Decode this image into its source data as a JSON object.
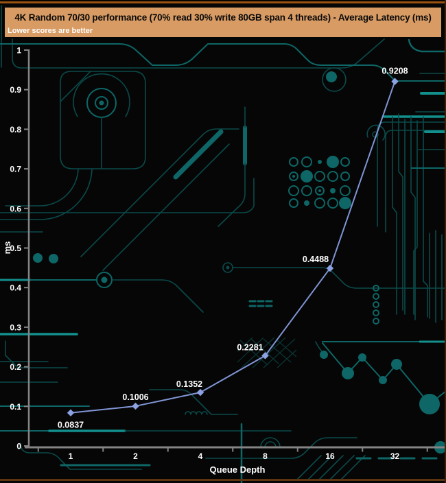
{
  "chart_data": {
    "type": "line",
    "title": "4K Random 70/30 performance (70% read 30% write 80GB span 4 threads) - Average Latency (ms)",
    "subtitle": "Lower scores are better",
    "categories": [
      "1",
      "2",
      "4",
      "8",
      "16",
      "32"
    ],
    "series": [
      {
        "name": "Average Latency",
        "values": [
          0.0837,
          0.1006,
          0.1352,
          0.2281,
          0.4488,
          0.9208
        ],
        "point_labels": [
          "0.0837",
          "0.1006",
          "0.1352",
          "0.2281",
          "0.4488",
          "0.9208"
        ]
      }
    ],
    "xlabel": "Queue Depth",
    "ylabel": "ms",
    "ylim": [
      0,
      1
    ],
    "ytick_step": 0.1,
    "ytick_labels": [
      "0",
      "0.1",
      "0.2",
      "0.3",
      "0.4",
      "0.5",
      "0.6",
      "0.7",
      "0.8",
      "0.9",
      "1"
    ],
    "grid": false,
    "legend": "none",
    "line_color": "#8095d5",
    "marker_color": "#8da2e2",
    "marker_shape": "diamond",
    "axis_color": "#848484",
    "tick_label_color": "#ffffff",
    "value_label_color": "#ffffff"
  },
  "colors": {
    "background": "#060606",
    "title_bar": "#d89b63",
    "border_top": "#9a5210",
    "border_bottom": "#5e330f",
    "circuit_faint": "#0a3636",
    "circuit_dim": "#0b4a4a",
    "circuit_mid": "#0e6666",
    "circuit_bright": "#12908d"
  }
}
